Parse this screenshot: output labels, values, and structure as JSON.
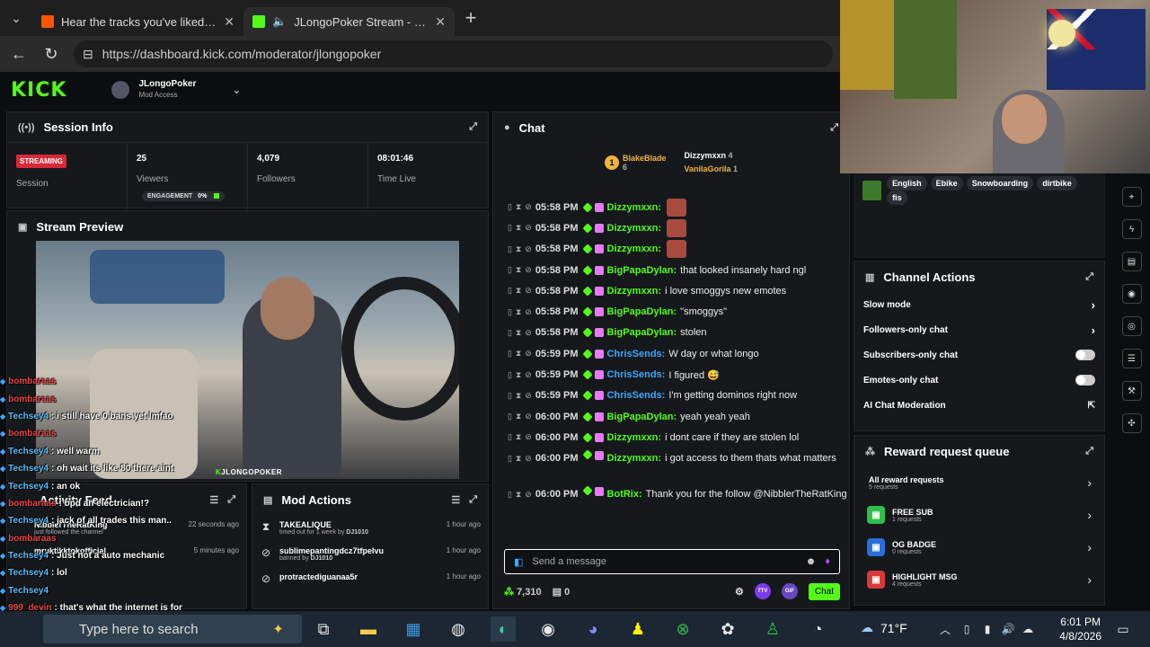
{
  "browser": {
    "tabs": [
      {
        "title": "Hear the tracks you've liked: on So",
        "favicon_color": "#ff5500"
      },
      {
        "title": "JLongoPoker Stream - Kick Da",
        "favicon_color": "#53fc18"
      }
    ],
    "url": "https://dashboard.kick.com/moderator/jlongopoker"
  },
  "header": {
    "logo": "KICK",
    "channel_name": "JLongoPoker",
    "access": "Mod Access"
  },
  "session": {
    "title": "Session Info",
    "status_badge": "STREAMING",
    "status_label": "Session",
    "viewers": "25",
    "viewers_label": "Viewers",
    "engagement_label": "ENGAGEMENT",
    "engagement": "0%",
    "followers": "4,079",
    "followers_label": "Followers",
    "time_live": "08:01:46",
    "time_live_label": "Time Live"
  },
  "preview": {
    "title": "Stream Preview",
    "overlay_tag": "JLONGOPOKER"
  },
  "activity": {
    "title": "Activity Feed",
    "items": [
      {
        "name": "NibblerTheRatKing",
        "sub": "just followed the channel",
        "time": "22 seconds ago"
      },
      {
        "name": "mruktikktokofficial",
        "sub": "",
        "time": "5 minutes ago"
      }
    ]
  },
  "mod_actions": {
    "title": "Mod Actions",
    "items": [
      {
        "name": "TAKEALIQUE",
        "sub": "timed out for 1 week by",
        "by": "DJ1010",
        "time": "1 hour ago",
        "icon": "hourglass-icon"
      },
      {
        "name": "sublimepantingdcz7tfpelvu",
        "sub": "banned by",
        "by": "DJ1010",
        "time": "1 hour ago",
        "icon": "ban-icon"
      },
      {
        "name": "protractediguanaa5r",
        "sub": "",
        "by": "",
        "time": "1 hour ago",
        "icon": "ban-icon"
      }
    ]
  },
  "chat": {
    "title": "Chat",
    "top_gifters": [
      {
        "name": "BlakeBlade",
        "count": "6",
        "color": "#f2b33d"
      },
      {
        "name": "Dizzymxxn",
        "count": "4",
        "color": "#ffffff"
      },
      {
        "name": "VanilaGorila",
        "count": "1",
        "color": "#f2b33d"
      }
    ],
    "messages": [
      {
        "time": "05:58 PM",
        "user": "Dizzymxxn:",
        "text": "",
        "color": "#53fc18",
        "emote": true
      },
      {
        "time": "05:58 PM",
        "user": "Dizzymxxn:",
        "text": "",
        "color": "#53fc18",
        "emote": true
      },
      {
        "time": "05:58 PM",
        "user": "Dizzymxxn:",
        "text": "",
        "color": "#53fc18",
        "emote": true
      },
      {
        "time": "05:58 PM",
        "user": "BigPapaDylan:",
        "text": "that looked insanely hard ngl",
        "color": "#53fc18",
        "emote": false
      },
      {
        "time": "05:58 PM",
        "user": "Dizzymxxn:",
        "text": "i love smoggys new emotes",
        "color": "#53fc18",
        "emote": false
      },
      {
        "time": "05:58 PM",
        "user": "BigPapaDylan:",
        "text": "\"smoggys\"",
        "color": "#53fc18",
        "emote": false
      },
      {
        "time": "05:58 PM",
        "user": "BigPapaDylan:",
        "text": "stolen",
        "color": "#53fc18",
        "emote": false
      },
      {
        "time": "05:59 PM",
        "user": "ChrisSends:",
        "text": "W day or what longo",
        "color": "#3ea6ff",
        "emote": false
      },
      {
        "time": "05:59 PM",
        "user": "ChrisSends:",
        "text": "I figured 😅",
        "color": "#3ea6ff",
        "emote": false
      },
      {
        "time": "05:59 PM",
        "user": "ChrisSends:",
        "text": "I'm getting dominos right now",
        "color": "#3ea6ff",
        "emote": false
      },
      {
        "time": "06:00 PM",
        "user": "BigPapaDylan:",
        "text": "yeah yeah yeah",
        "color": "#53fc18",
        "emote": false
      },
      {
        "time": "06:00 PM",
        "user": "Dizzymxxn:",
        "text": "i dont care if they are stolen lol",
        "color": "#53fc18",
        "emote": false
      },
      {
        "time": "06:00 PM",
        "user": "Dizzymxxn:",
        "text": "i got access to them thats what matters",
        "color": "#53fc18",
        "emote": false
      },
      {
        "time": "06:00 PM",
        "user": "BotRix:",
        "text": "Thank you for the follow @NibblerTheRatKing",
        "color": "#53fc18",
        "emote": false
      }
    ],
    "input_placeholder": "Send a message",
    "points": "7,310",
    "mod_count": "0",
    "badge_7tv": "7TV",
    "badge_gif": "GIF",
    "send_label": "Chat"
  },
  "tags": [
    "English",
    "Ebike",
    "Snowboarding",
    "dirtbike",
    "fis"
  ],
  "channel_actions": {
    "title": "Channel Actions",
    "items": [
      {
        "label": "Slow mode",
        "control": "arrow"
      },
      {
        "label": "Followers-only chat",
        "control": "arrow"
      },
      {
        "label": "Subscribers-only chat",
        "control": "toggle"
      },
      {
        "label": "Emotes-only chat",
        "control": "toggle"
      },
      {
        "label": "AI Chat Moderation",
        "control": "external"
      }
    ]
  },
  "rewards": {
    "title": "Reward request queue",
    "items": [
      {
        "name": "All reward requests",
        "count": "5 requests",
        "icon_color": ""
      },
      {
        "name": "FREE SUB",
        "count": "1 requests",
        "icon_color": "#2fbf4a"
      },
      {
        "name": "OG BADGE",
        "count": "0 requests",
        "icon_color": "#2a6ddb"
      },
      {
        "name": "HIGHLIGHT MSG",
        "count": "4 requests",
        "icon_color": "#d83a3a"
      }
    ]
  },
  "overlay_chat": [
    {
      "user": "bombaraas",
      "text": "",
      "blue": false
    },
    {
      "user": "bombaraas",
      "text": "",
      "blue": false
    },
    {
      "user": "Techsey4",
      "text": ": i still have 0 bans yet lmfao",
      "blue": true
    },
    {
      "user": "bombaraas",
      "text": "",
      "blue": false
    },
    {
      "user": "Techsey4",
      "text": ": well warm",
      "blue": true
    },
    {
      "user": "Techsey4",
      "text": ": oh wait its like 80 there aint",
      "blue": true
    },
    {
      "user": "Techsey4",
      "text": ": an ok",
      "blue": true
    },
    {
      "user": "bombaraas",
      "text": ": bpd an electrician!?",
      "blue": false
    },
    {
      "user": "Techsey4",
      "text": ": jack of all trades this man..",
      "blue": true
    },
    {
      "user": "bombaraas",
      "text": "",
      "blue": false
    },
    {
      "user": "Techsey4",
      "text": ": Just not a auto mechanic",
      "blue": true
    },
    {
      "user": "Techsey4",
      "text": ": lol",
      "blue": true
    },
    {
      "user": "Techsey4",
      "text": "",
      "blue": true
    },
    {
      "user": "999_devin",
      "text": ": that's what the internet is for",
      "blue": false
    },
    {
      "user": "999_devin",
      "text": "",
      "blue": false
    }
  ],
  "taskbar": {
    "search_placeholder": "Type here to search",
    "temperature": "71°F",
    "time": "6:01 PM",
    "date": "4/8/2026"
  }
}
